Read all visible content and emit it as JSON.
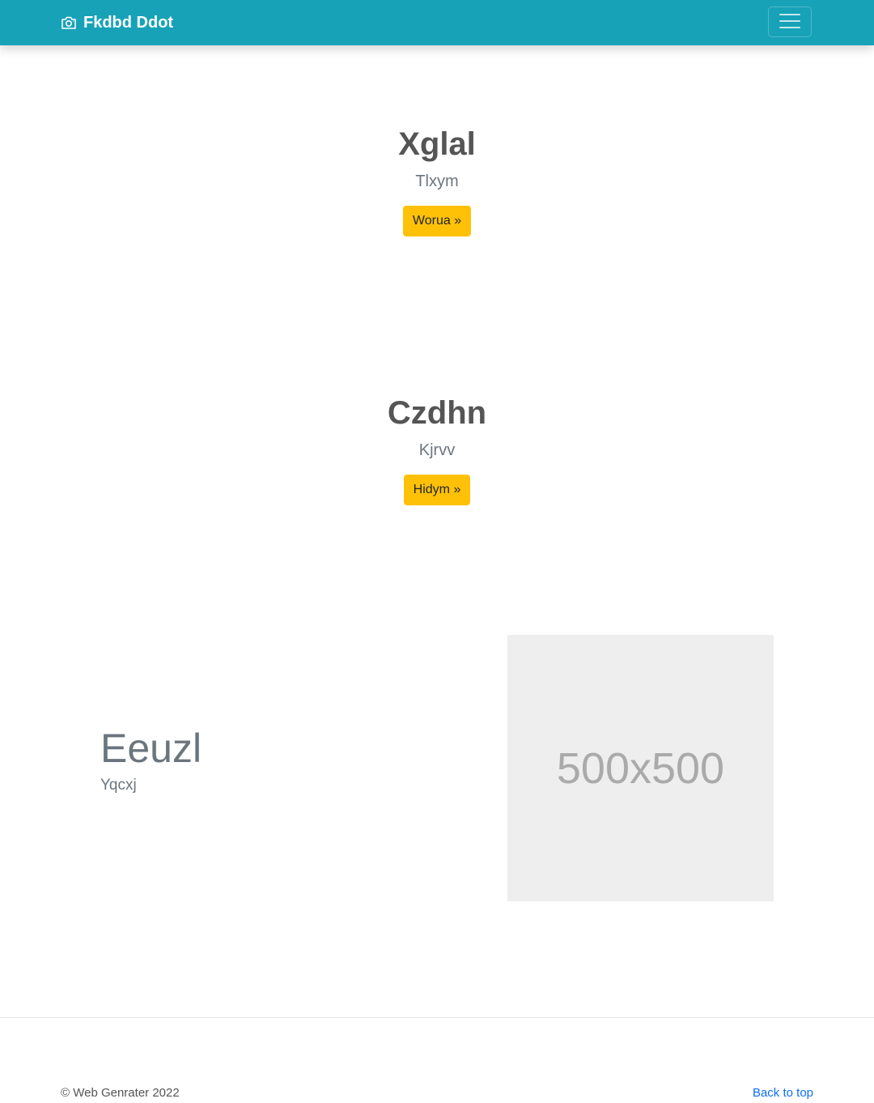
{
  "navbar": {
    "brand_icon": "camera-icon",
    "brand_text": "Fkdbd Ddot",
    "toggler_icon": "hamburger-menu-icon",
    "background_color": "#17a2b8"
  },
  "sections": [
    {
      "title": "Xglal",
      "subtitle": "Tlxym",
      "button_label": "Worua »"
    },
    {
      "title": "Czdhn",
      "subtitle": "Kjrvv",
      "button_label": "Hidym »"
    }
  ],
  "feature": {
    "title": "Eeuzl",
    "subtitle": "Yqcxj",
    "image_placeholder_text": "500x500"
  },
  "footer": {
    "copyright": "© Web Genrater 2022",
    "back_to_top": "Back to top"
  },
  "colors": {
    "button": "#ffc107",
    "link": "#0d6efd",
    "placeholder_bg": "#eeeeee"
  }
}
